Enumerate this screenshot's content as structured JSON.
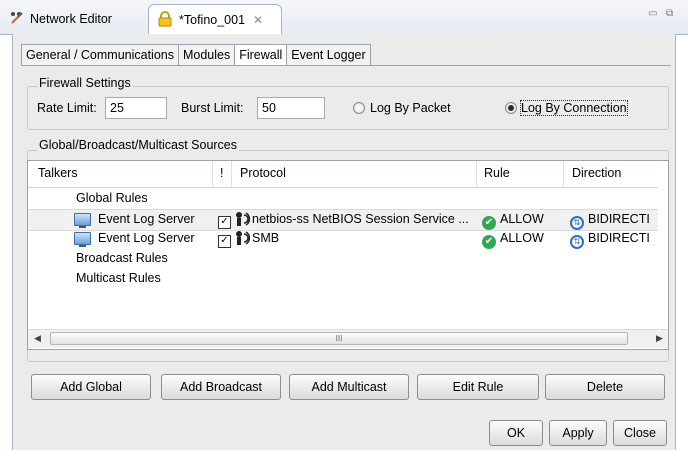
{
  "editor_tabs": {
    "inactive_label": "Network Editor",
    "active_label": "*Tofino_001"
  },
  "panel_tabs": [
    "General / Communications",
    "Modules",
    "Firewall",
    "Event Logger"
  ],
  "firewall_settings": {
    "title": "Firewall Settings",
    "rate_label": "Rate Limit:",
    "rate_value": "25",
    "burst_label": "Burst Limit:",
    "burst_value": "50",
    "log_packet": "Log By Packet",
    "log_connection": "Log By Connection",
    "selected": "Log By Connection"
  },
  "sources": {
    "title": "Global/Broadcast/Multicast Sources",
    "headers": {
      "talkers": "Talkers",
      "flag": "!",
      "protocol": "Protocol",
      "rule": "Rule",
      "direction": "Direction"
    },
    "global_rules": "Global Rules",
    "rows": [
      {
        "talker": "Event Log Server",
        "checked": true,
        "protocol": "netbios-ss  NetBIOS Session Service ...",
        "rule": "ALLOW",
        "direction": "BIDIRECTI"
      },
      {
        "talker": "Event Log Server",
        "checked": true,
        "protocol": "SMB",
        "rule": "ALLOW",
        "direction": "BIDIRECTI"
      }
    ],
    "broadcast_rules": "Broadcast Rules",
    "multicast_rules": "Multicast Rules",
    "scroll_thumb_grip": "III"
  },
  "buttons": {
    "add_global": "Add Global",
    "add_broadcast": "Add Broadcast",
    "add_multicast": "Add Multicast",
    "edit_rule": "Edit Rule",
    "delete": "Delete",
    "ok": "OK",
    "apply": "Apply",
    "close": "Close"
  },
  "colors": {
    "allow_green": "#33a852",
    "bidirectional_blue": "#2f6fc0",
    "tab_border": "#a6b4c8"
  }
}
